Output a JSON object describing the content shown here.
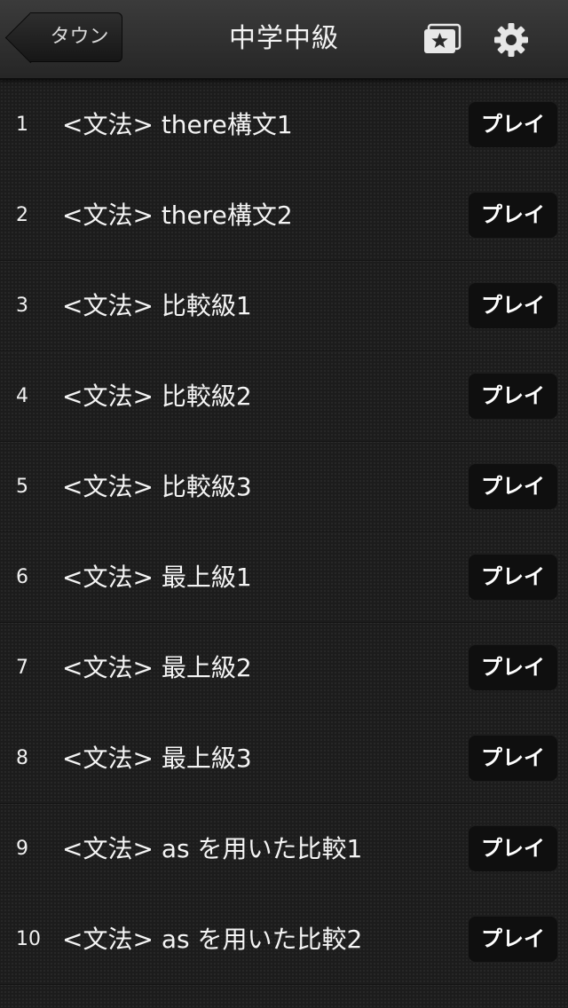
{
  "navbar": {
    "back_label": "タウン",
    "title": "中学中級",
    "favorites_icon": "star-card-icon",
    "settings_icon": "gear-icon"
  },
  "colors": {
    "background": "#1c1c1c",
    "navbar": "#2f2f2f",
    "text": "#f4f4f4",
    "button": "#0f0f0f"
  },
  "lessons": [
    {
      "number": "1",
      "title": "<文法> there構文1",
      "action": "プレイ"
    },
    {
      "number": "2",
      "title": "<文法> there構文2",
      "action": "プレイ"
    },
    {
      "number": "3",
      "title": "<文法> 比較級1",
      "action": "プレイ"
    },
    {
      "number": "4",
      "title": "<文法> 比較級2",
      "action": "プレイ"
    },
    {
      "number": "5",
      "title": "<文法> 比較級3",
      "action": "プレイ"
    },
    {
      "number": "6",
      "title": "<文法> 最上級1",
      "action": "プレイ"
    },
    {
      "number": "7",
      "title": "<文法> 最上級2",
      "action": "プレイ"
    },
    {
      "number": "8",
      "title": "<文法> 最上級3",
      "action": "プレイ"
    },
    {
      "number": "9",
      "title": "<文法> as を用いた比較1",
      "action": "プレイ"
    },
    {
      "number": "10",
      "title": "<文法> as を用いた比較2",
      "action": "プレイ"
    }
  ]
}
